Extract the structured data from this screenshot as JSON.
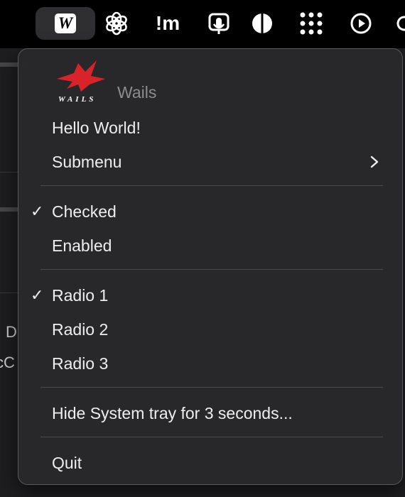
{
  "menubar": {
    "active_app_badge": "W",
    "icons": [
      "openai-icon",
      "im-icon",
      "voice-memo-icon",
      "contrast-icon",
      "grid-dots-icon",
      "play-circle-icon"
    ],
    "im_label": "!m"
  },
  "background": {
    "text_1": "D",
    "text_2": "cC"
  },
  "menu": {
    "app_name": "Wails",
    "logo_text": "WAILS",
    "items": {
      "hello": "Hello World!",
      "submenu": "Submenu",
      "checked": "Checked",
      "enabled": "Enabled",
      "radio1": "Radio 1",
      "radio2": "Radio 2",
      "radio3": "Radio 3",
      "hide_tray": "Hide System tray for 3 seconds...",
      "quit": "Quit"
    },
    "check_glyph": "✓",
    "checked_state": true,
    "radio_selected": "Radio 1"
  },
  "colors": {
    "menu_bg": "#28282b",
    "logo_red": "#d8232a",
    "text": "#eeeeee",
    "muted": "#8c8c90"
  }
}
